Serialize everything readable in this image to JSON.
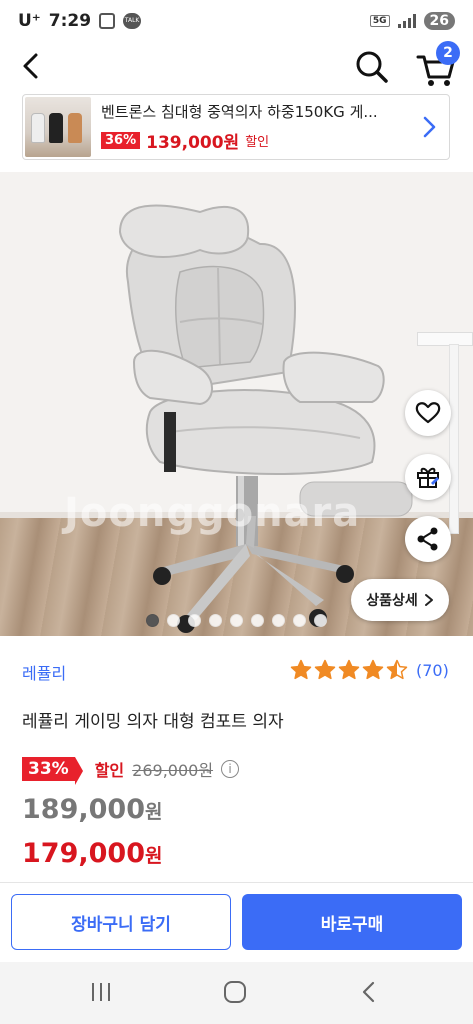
{
  "status_bar": {
    "carrier": "U⁺",
    "time": "7:29",
    "talk_label": "TALK",
    "network": "5G",
    "battery": "26"
  },
  "header": {
    "cart_count": "2"
  },
  "promo": {
    "title": "벤트론스 침대형 중역의자 하중150KG 게...",
    "discount": "36%",
    "price": "139,000원",
    "sale_label": "할인"
  },
  "hero": {
    "watermark": "Joonggonara",
    "slide_count": 9,
    "active_slide": 1,
    "detail_button": "상품상세"
  },
  "product": {
    "brand": "레퓰리",
    "rating": 4.5,
    "review_count": "(70)",
    "title": "레퓰리 게이밍 의자 대형 컴포트 의자",
    "discount": "33%",
    "sale_label": "할인",
    "original_price": "269,000원",
    "price_number": "189,000",
    "price_unit": "원",
    "final_price_number": "179,000",
    "final_price_unit": "원"
  },
  "actions": {
    "add_to_cart": "장바구니 담기",
    "buy_now": "바로구매"
  },
  "colors": {
    "accent": "#3b6cf6",
    "sale_red": "#d8161f",
    "star": "#f08a24"
  }
}
